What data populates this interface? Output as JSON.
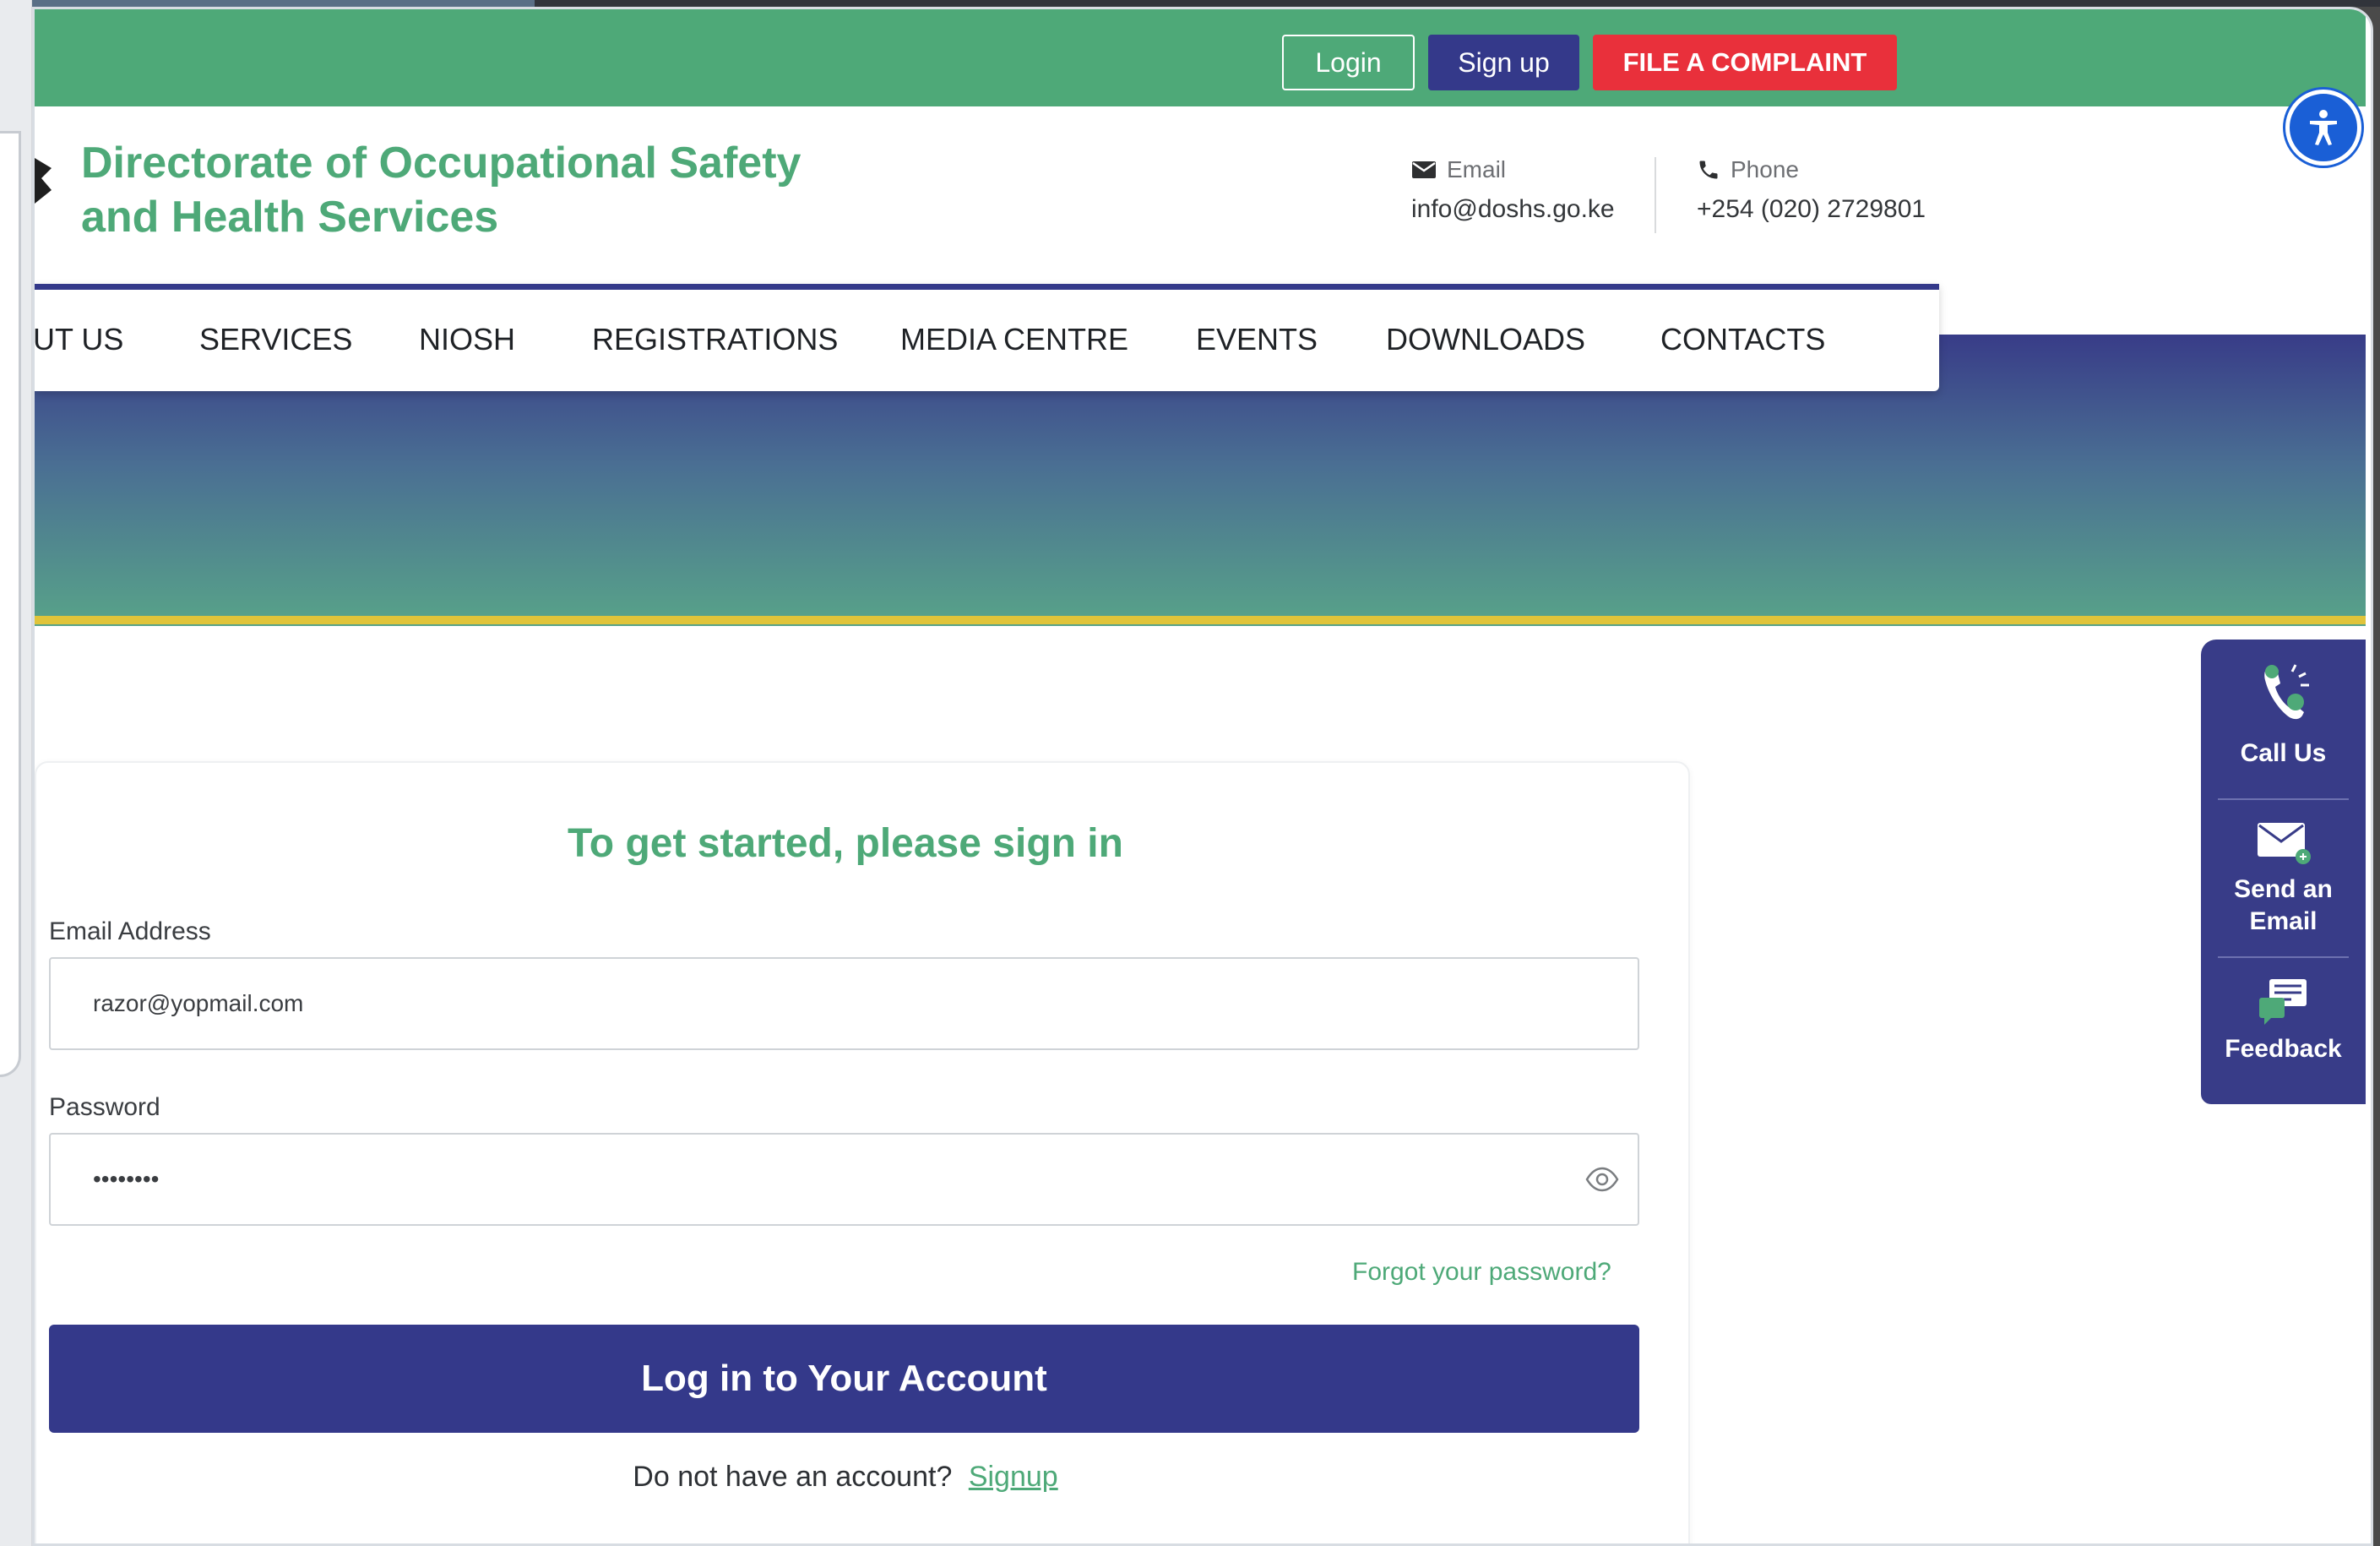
{
  "topbar": {
    "login_label": "Login",
    "signup_label": "Sign up",
    "complaint_label": "FILE A COMPLAINT"
  },
  "header": {
    "title_line1": "Directorate of Occupational Safety",
    "title_line2": "and Health Services",
    "email_label": "Email",
    "email_value": "info@doshs.go.ke",
    "phone_label": "Phone",
    "phone_value": "+254 (020) 2729801"
  },
  "nav": {
    "items": [
      " UT US",
      "SERVICES",
      "NIOSH",
      "REGISTRATIONS",
      "MEDIA CENTRE",
      "EVENTS",
      "DOWNLOADS",
      "CONTACTS"
    ]
  },
  "side_panel": {
    "call_label": "Call Us",
    "email_line1": "Send an",
    "email_line2": "Email",
    "feedback_label": "Feedback"
  },
  "signin": {
    "title": "To get started, please sign in",
    "email_label": "Email Address",
    "email_value": "razor@yopmail.com",
    "password_label": "Password",
    "password_value": "••••••••",
    "forgot_label": "Forgot your password?",
    "submit_label": "Log in to Your Account",
    "no_account_text": "Do not have an account?",
    "signup_link": "Signup"
  },
  "colors": {
    "brand_green": "#4ea978",
    "brand_navy": "#34398a",
    "complaint_red": "#e9303b",
    "accent_yellow": "#e0c43a",
    "a11y_blue": "#1a5fd6"
  },
  "icons": [
    "email-icon",
    "phone-icon",
    "accessibility-icon",
    "call-icon",
    "send-email-icon",
    "feedback-icon",
    "eye-icon"
  ]
}
